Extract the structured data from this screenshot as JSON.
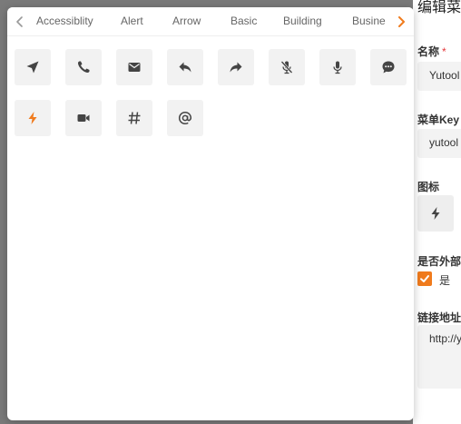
{
  "colors": {
    "accent": "#f07b1d",
    "icon": "#444444",
    "tab_text": "#666666",
    "cell_bg": "#f2f2f2"
  },
  "tabs": [
    {
      "label": "Accessiblity"
    },
    {
      "label": "Alert"
    },
    {
      "label": "Arrow"
    },
    {
      "label": "Basic"
    },
    {
      "label": "Building"
    },
    {
      "label": "Busine"
    }
  ],
  "icons": [
    {
      "name": "send-icon",
      "selected": false
    },
    {
      "name": "phone-icon",
      "selected": false
    },
    {
      "name": "mail-icon",
      "selected": false
    },
    {
      "name": "reply-icon",
      "selected": false
    },
    {
      "name": "share-forward-icon",
      "selected": false
    },
    {
      "name": "mic-off-icon",
      "selected": false
    },
    {
      "name": "mic-icon",
      "selected": false
    },
    {
      "name": "chat-bubble-icon",
      "selected": false
    },
    {
      "name": "flash-icon",
      "selected": true
    },
    {
      "name": "video-camera-icon",
      "selected": false
    },
    {
      "name": "hashtag-icon",
      "selected": false
    },
    {
      "name": "at-sign-icon",
      "selected": false
    }
  ],
  "side_panel": {
    "title": "编辑菜",
    "name_label": "名称",
    "required_mark": "*",
    "name_value": "Yutool",
    "key_label": "菜单Key",
    "key_value": "yutool",
    "icon_label": "图标",
    "icon_value": "flash-icon",
    "external_label": "是否外部",
    "external_checked": true,
    "external_option": "是",
    "link_label": "链接地址",
    "link_value": "http://y"
  }
}
